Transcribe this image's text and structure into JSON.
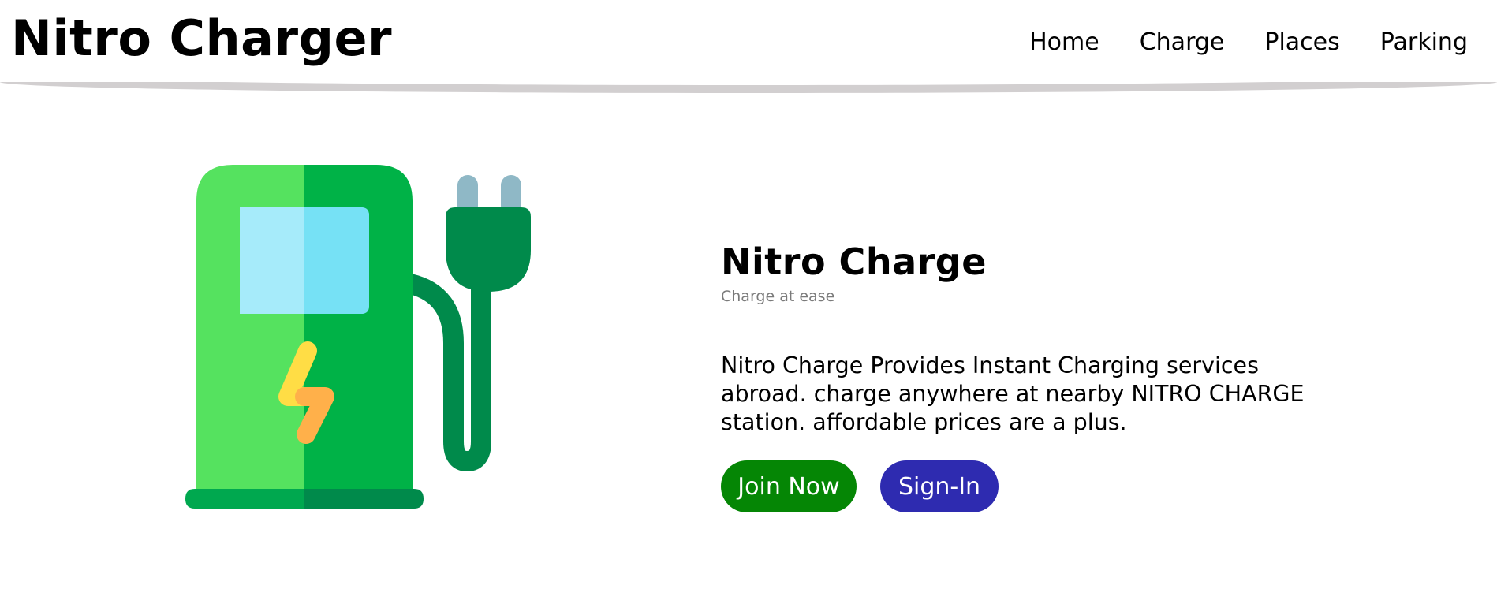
{
  "header": {
    "brand": "Nitro Charger",
    "nav": [
      "Home",
      "Charge",
      "Places",
      "Parking"
    ]
  },
  "hero": {
    "icon": "ev-charging-station-icon",
    "title": "Nitro Charge",
    "subtitle": "Charge at ease",
    "description": "Nitro Charge Provides Instant Charging services abroad. charge anywhere at nearby NITRO CHARGE station. affordable prices are a plus.",
    "join_label": "Join Now",
    "signin_label": "Sign-In"
  },
  "colors": {
    "join_button": "#058605",
    "signin_button": "#2e2bb0",
    "station_light_green": "#55e25f",
    "station_dark_green": "#00b247",
    "plug_green": "#008a4b",
    "screen_light": "#a6ebfa",
    "screen_dark": "#76e1f5",
    "bolt_yellow": "#ffdd45",
    "bolt_orange": "#ffb04a",
    "prong_blue": "#8fb8c6"
  }
}
